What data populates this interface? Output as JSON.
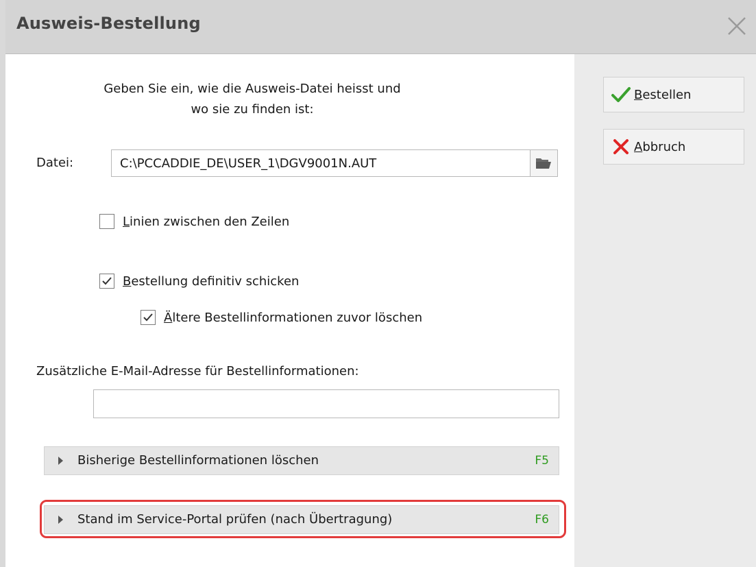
{
  "window": {
    "title": "Ausweis-Bestellung",
    "close_icon": "close-icon"
  },
  "form": {
    "prompt_line1": "Geben Sie ein, wie die Ausweis-Datei heisst und",
    "prompt_line2": "wo sie zu finden ist:",
    "file_label": "Datei:",
    "file_value": "C:\\PCCADDIE_DE\\USER_1\\DGV9001N.AUT",
    "browse_icon": "folder-open-icon",
    "lines_checkbox": {
      "label_first": "L",
      "label_rest": "inien zwischen den Zeilen",
      "checked": false
    },
    "send_checkbox": {
      "label_first": "B",
      "label_rest": "estellung definitiv schicken",
      "checked": true
    },
    "delete_old_checkbox": {
      "label_first": "Ä",
      "label_rest": "ltere Bestellinformationen zuvor löschen",
      "checked": true
    },
    "email_label": "Zusätzliche E-Mail-Adresse für Bestellinformationen:",
    "email_value": ""
  },
  "sections": [
    {
      "label": "Bisherige Bestellinformationen löschen",
      "key": "F5",
      "expanded": false
    },
    {
      "label": "Stand im Service-Portal prüfen (nach Übertragung)",
      "key": "F6",
      "expanded": false,
      "highlighted": true
    }
  ],
  "buttons": {
    "order": {
      "label_first": "B",
      "label_rest": "estellen",
      "icon": "check-icon",
      "icon_color": "#3aa12e"
    },
    "cancel": {
      "label_first": "A",
      "label_rest": "bbruch",
      "icon": "cross-icon",
      "icon_color": "#e02424"
    }
  },
  "colors": {
    "highlight": "#e23b3b",
    "fkey": "#2e9b1f"
  }
}
